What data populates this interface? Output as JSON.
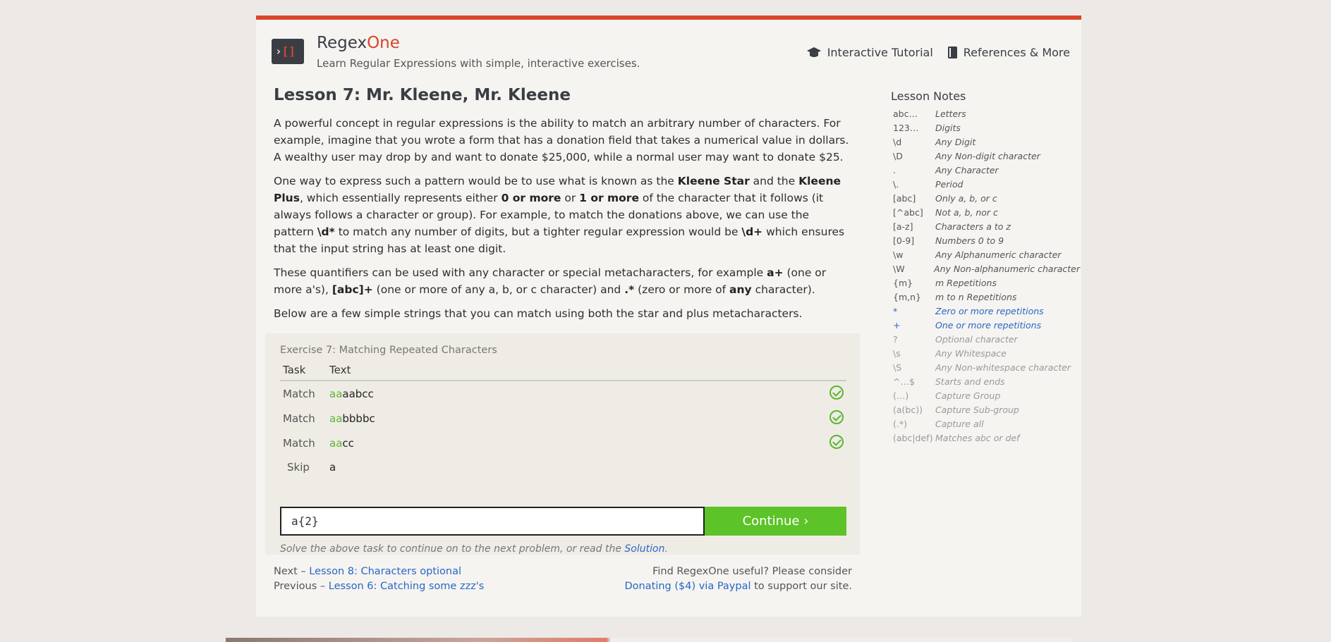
{
  "header": {
    "logo_text": ">[]",
    "brand_main": "Regex",
    "brand_accent": "One",
    "tagline": "Learn Regular Expressions with simple, interactive exercises.",
    "nav": [
      {
        "label": "Interactive Tutorial",
        "icon": "graduation-cap-icon"
      },
      {
        "label": "References & More",
        "icon": "book-icon"
      }
    ]
  },
  "lesson": {
    "title": "Lesson 7: Mr. Kleene, Mr. Kleene",
    "p1": "A powerful concept in regular expressions is the ability to match an arbitrary number of characters. For example, imagine that you wrote a form that has a donation field that takes a numerical value in dollars. A wealthy user may drop by and want to donate $25,000, while a normal user may want to donate $25.",
    "p2": {
      "a": "One way to express such a pattern would be to use what is known as the ",
      "b1": "Kleene Star",
      "c": " and the ",
      "b2": "Kleene Plus",
      "d": ", which essentially represents either ",
      "b3": "0 or more",
      "e": " or ",
      "b4": "1 or more",
      "f": " of the character that it follows (it always follows a character or group). For example, to match the donations above, we can use the pattern ",
      "b5": "\\d*",
      "g": " to match any number of digits, but a tighter regular expression would be ",
      "b6": "\\d+",
      "h": " which ensures that the input string has at least one digit."
    },
    "p3": {
      "a": "These quantifiers can be used with any character or special metacharacters, for example ",
      "b1": "a+",
      "c": " (one or more a's), ",
      "b2": "[abc]+",
      "d": " (one or more of any a, b, or c character) and ",
      "b3": ".*",
      "e": " (zero or more of ",
      "b4": "any",
      "f": " character)."
    },
    "p4": "Below are a few simple strings that you can match using both the star and plus metacharacters."
  },
  "exercise": {
    "title": "Exercise 7: Matching Repeated Characters",
    "col_task": "Task",
    "col_text": "Text",
    "rows": [
      {
        "task": "Match",
        "hl": "aa",
        "rest": "aabcc",
        "done": true
      },
      {
        "task": "Match",
        "hl": "aa",
        "rest": "bbbbc",
        "done": true
      },
      {
        "task": "Match",
        "hl": "aa",
        "rest": "cc",
        "done": true
      },
      {
        "task": "Skip",
        "hl": "",
        "rest": "a",
        "done": false
      }
    ],
    "input_value": "a{2}",
    "continue_label": "Continue ›",
    "hint_text": "Solve the above task to continue on to the next problem, or read the ",
    "hint_link": "Solution",
    "hint_end": "."
  },
  "footer": {
    "next_prefix": "Next – ",
    "next_link": "Lesson 8: Characters optional",
    "prev_prefix": "Previous – ",
    "prev_link": "Lesson 6: Catching some zzz's",
    "support_line": "Find RegexOne useful? Please consider",
    "donate_link": "Donating ($4) via Paypal",
    "support_end": " to support our site."
  },
  "notes": {
    "title": "Lesson Notes",
    "items": [
      {
        "sym": "abc…",
        "desc": "Letters",
        "state": "done"
      },
      {
        "sym": "123…",
        "desc": "Digits",
        "state": "done"
      },
      {
        "sym": "\\d",
        "desc": "Any Digit",
        "state": "done"
      },
      {
        "sym": "\\D",
        "desc": "Any Non-digit character",
        "state": "done"
      },
      {
        "sym": ".",
        "desc": "Any Character",
        "state": "done"
      },
      {
        "sym": "\\.",
        "desc": "Period",
        "state": "done"
      },
      {
        "sym": "[abc]",
        "desc": "Only a, b, or c",
        "state": "done"
      },
      {
        "sym": "[^abc]",
        "desc": "Not a, b, nor c",
        "state": "done"
      },
      {
        "sym": "[a-z]",
        "desc": "Characters a to z",
        "state": "done"
      },
      {
        "sym": "[0-9]",
        "desc": "Numbers 0 to 9",
        "state": "done"
      },
      {
        "sym": "\\w",
        "desc": "Any Alphanumeric character",
        "state": "done"
      },
      {
        "sym": "\\W",
        "desc": "Any Non-alphanumeric character",
        "state": "done"
      },
      {
        "sym": "{m}",
        "desc": "m Repetitions",
        "state": "done"
      },
      {
        "sym": "{m,n}",
        "desc": "m to n Repetitions",
        "state": "done"
      },
      {
        "sym": "*",
        "desc": "Zero or more repetitions",
        "state": "active"
      },
      {
        "sym": "+",
        "desc": "One or more repetitions",
        "state": "active"
      },
      {
        "sym": "?",
        "desc": "Optional character",
        "state": "future"
      },
      {
        "sym": "\\s",
        "desc": "Any Whitespace",
        "state": "future"
      },
      {
        "sym": "\\S",
        "desc": "Any Non-whitespace character",
        "state": "future"
      },
      {
        "sym": "^…$",
        "desc": "Starts and ends",
        "state": "future"
      },
      {
        "sym": "(…)",
        "desc": "Capture Group",
        "state": "future"
      },
      {
        "sym": "(a(bc))",
        "desc": "Capture Sub-group",
        "state": "future"
      },
      {
        "sym": "(.*)",
        "desc": "Capture all",
        "state": "future"
      },
      {
        "sym": "(abc|def)",
        "desc": "Matches abc or def",
        "state": "future"
      }
    ]
  },
  "colors": {
    "accent": "#d9452b",
    "success": "#5cc329",
    "link": "#2a66c4"
  }
}
